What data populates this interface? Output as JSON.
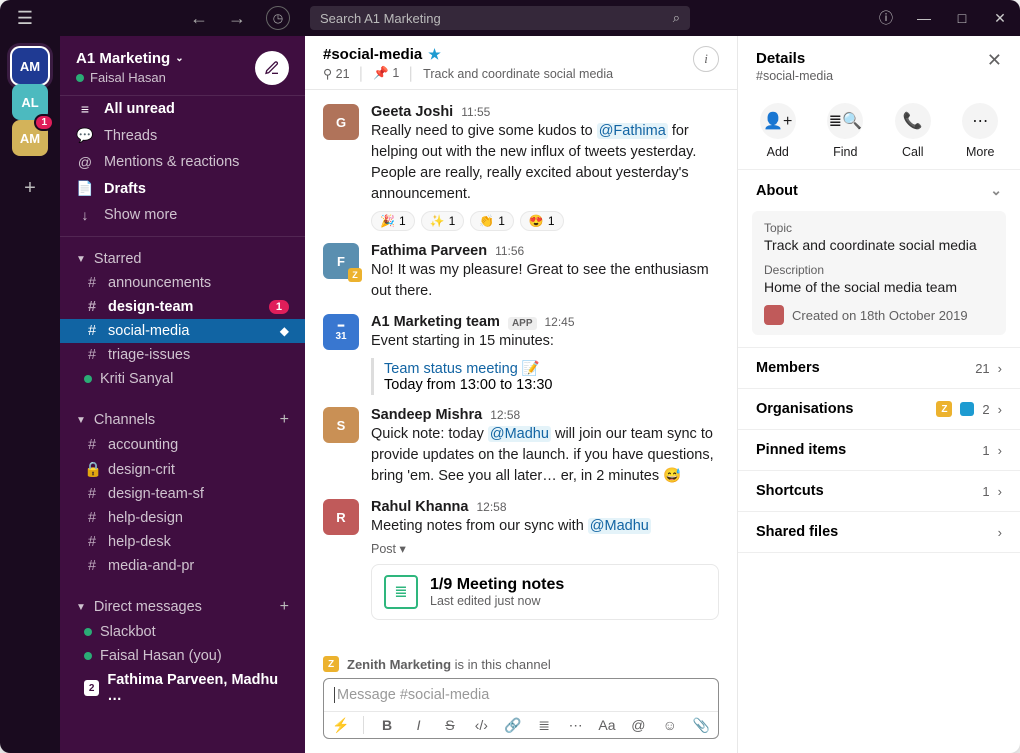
{
  "search": {
    "placeholder": "Search A1 Marketing"
  },
  "workspaces": [
    {
      "abbr": "AM",
      "color": "blue"
    },
    {
      "abbr": "AL",
      "color": "teal"
    },
    {
      "abbr": "AM",
      "color": "gold",
      "badge": "1"
    }
  ],
  "workspace": {
    "name": "A1 Marketing",
    "user": "Faisal Hasan"
  },
  "sidebar": {
    "top": [
      {
        "icon": "≡",
        "label": "All unread",
        "bold": true
      },
      {
        "icon": "💬",
        "label": "Threads"
      },
      {
        "icon": "@",
        "label": "Mentions & reactions"
      },
      {
        "icon": "📄",
        "label": "Drafts",
        "bold": true
      },
      {
        "icon": "↓",
        "label": "Show more"
      }
    ],
    "sections": {
      "starred": {
        "label": "Starred",
        "items": [
          {
            "prefix": "#",
            "name": "announcements"
          },
          {
            "prefix": "#",
            "name": "design-team",
            "bold": true,
            "badge": "1"
          },
          {
            "prefix": "#",
            "name": "social-media",
            "selected": true,
            "active_icon": "◆"
          },
          {
            "prefix": "#",
            "name": "triage-issues"
          },
          {
            "prefix": "●",
            "name": "Kriti Sanyal",
            "presence": true
          }
        ]
      },
      "channels": {
        "label": "Channels",
        "items": [
          {
            "prefix": "#",
            "name": "accounting"
          },
          {
            "prefix": "🔒",
            "name": "design-crit"
          },
          {
            "prefix": "#",
            "name": "design-team-sf"
          },
          {
            "prefix": "#",
            "name": "help-design"
          },
          {
            "prefix": "#",
            "name": "help-desk"
          },
          {
            "prefix": "#",
            "name": "media-and-pr"
          }
        ]
      },
      "dms": {
        "label": "Direct messages",
        "items": [
          {
            "prefix": "●",
            "name": "Slackbot",
            "presence": true
          },
          {
            "prefix": "●",
            "name": "Faisal Hasan (you)",
            "presence": true
          },
          {
            "prefix": "2",
            "name": "Fathima Parveen, Madhu …",
            "bold": true,
            "square": true
          }
        ]
      }
    }
  },
  "channel": {
    "name": "#social-media",
    "members": "21",
    "pins": "1",
    "topic": "Track and coordinate social media",
    "members_icon_prefix": "⚲"
  },
  "messages": [
    {
      "author": "Geeta Joshi",
      "time": "11:55",
      "avatar": "g",
      "text_pre": "Really need to give some kudos to ",
      "mention": "@Fathima",
      "text_post": " for helping out with the new influx of tweets yesterday. People are really, really excited about yesterday's announcement.",
      "reactions": [
        {
          "emoji": "🎉",
          "count": "1"
        },
        {
          "emoji": "✨",
          "count": "1"
        },
        {
          "emoji": "👏",
          "count": "1"
        },
        {
          "emoji": "😍",
          "count": "1"
        }
      ]
    },
    {
      "author": "Fathima Parveen",
      "time": "11:56",
      "avatar": "f",
      "zenith": true,
      "text": "No! It was my pleasure! Great to see the enthusiasm out there."
    },
    {
      "author": "A1 Marketing team",
      "time": "12:45",
      "avatar": "cal",
      "app": "APP",
      "text": "Event starting in 15 minutes:",
      "block": {
        "link": "Team status meeting",
        "emoji": "📝",
        "sub": "Today from 13:00 to 13:30"
      }
    },
    {
      "author": "Sandeep Mishra",
      "time": "12:58",
      "avatar": "s",
      "text_pre": "Quick note: today ",
      "mention": "@Madhu",
      "text_post": " will join our team sync to provide updates on the launch. if you have questions, bring 'em. See you all later… er, in 2 minutes 😅"
    },
    {
      "author": "Rahul Khanna",
      "time": "12:58",
      "avatar": "r",
      "text_pre": "Meeting notes from our sync with ",
      "mention": "@Madhu",
      "post": {
        "label": "Post ▾",
        "title": "1/9 Meeting notes",
        "sub": "Last edited just now"
      }
    }
  ],
  "composer": {
    "shared_org": "Zenith Marketing",
    "shared_suffix": " is in this channel",
    "placeholder": "Message #social-media"
  },
  "details": {
    "title": "Details",
    "subtitle": "#social-media",
    "quick": [
      {
        "icon": "👤+",
        "label": "Add"
      },
      {
        "icon": "≣🔍",
        "label": "Find"
      },
      {
        "icon": "📞",
        "label": "Call"
      },
      {
        "icon": "⋯",
        "label": "More"
      }
    ],
    "about": {
      "label": "About",
      "topic_label": "Topic",
      "topic": "Track and coordinate social media",
      "desc_label": "Description",
      "desc": "Home of the social media team",
      "created": "Created on 18th October 2019"
    },
    "sections": [
      {
        "label": "Members",
        "count": "21"
      },
      {
        "label": "Organisations",
        "count": "2",
        "orgs": true
      },
      {
        "label": "Pinned items",
        "count": "1"
      },
      {
        "label": "Shortcuts",
        "count": "1"
      },
      {
        "label": "Shared files",
        "count": ""
      }
    ]
  }
}
